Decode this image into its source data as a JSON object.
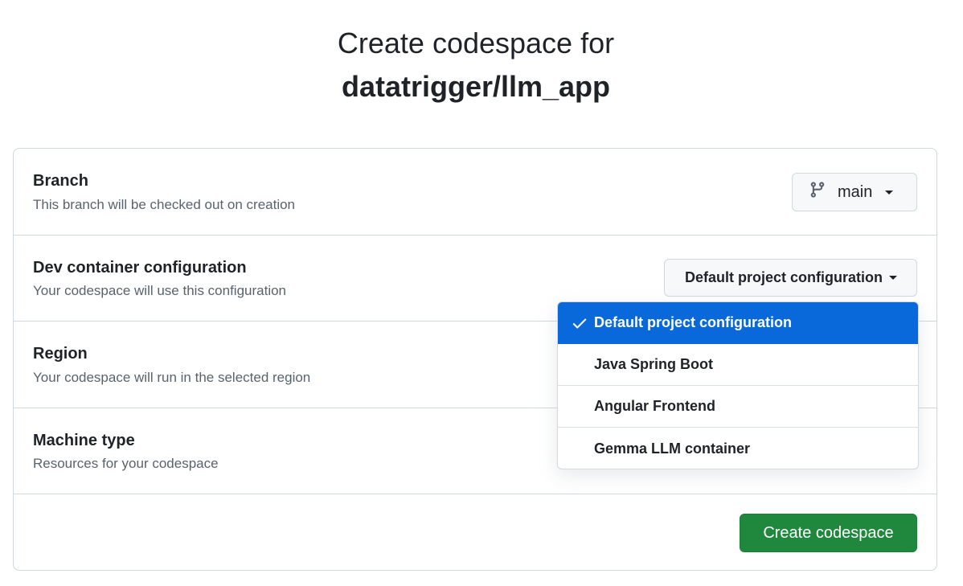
{
  "header": {
    "title": "Create codespace for",
    "repo": "datatrigger/llm_app"
  },
  "branch": {
    "label": "Branch",
    "description": "This branch will be checked out on creation",
    "value": "main"
  },
  "dev_container": {
    "label": "Dev container configuration",
    "description": "Your codespace will use this configuration",
    "value": "Default project configuration"
  },
  "region": {
    "label": "Region",
    "description": "Your codespace will run in the selected region"
  },
  "machine_type": {
    "label": "Machine type",
    "description": "Resources for your codespace"
  },
  "dropdown": {
    "items": [
      {
        "label": "Default project configuration",
        "selected": true
      },
      {
        "label": "Java Spring Boot",
        "selected": false
      },
      {
        "label": "Angular Frontend",
        "selected": false
      },
      {
        "label": "Gemma LLM container",
        "selected": false
      }
    ]
  },
  "actions": {
    "create_label": "Create codespace"
  },
  "colors": {
    "primary_green": "#1f883d",
    "selected_blue": "#0969da",
    "border": "#d0d7de",
    "muted_text": "#59636e"
  },
  "icons": {
    "branch": "git-branch-icon",
    "caret": "triangle-down-icon",
    "check": "check-icon"
  }
}
